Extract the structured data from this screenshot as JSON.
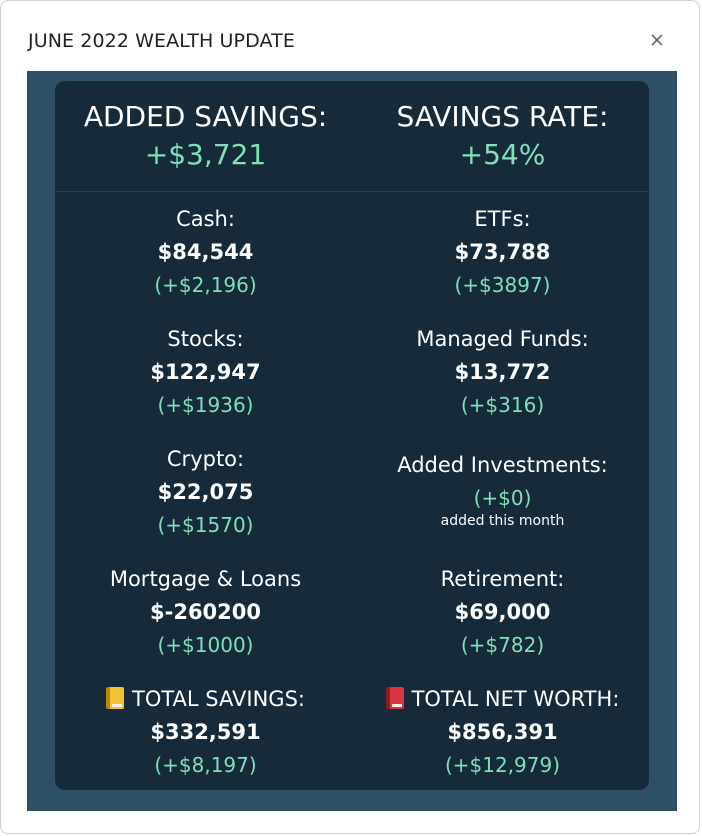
{
  "window": {
    "title": "JUNE 2022 WEALTH UPDATE",
    "close_icon": "close-icon"
  },
  "header": {
    "added_savings_label": "ADDED SAVINGS:",
    "added_savings_value": "+$3,721",
    "savings_rate_label": "SAVINGS RATE:",
    "savings_rate_value": "+54%"
  },
  "rows": [
    {
      "left": {
        "label": "Cash:",
        "value": "$84,544",
        "change": "(+$2,196)"
      },
      "right": {
        "label": "ETFs:",
        "value": "$73,788",
        "change": "(+$3897)"
      }
    },
    {
      "left": {
        "label": "Stocks:",
        "value": "$122,947",
        "change": "(+$1936)"
      },
      "right": {
        "label": "Managed Funds:",
        "value": "$13,772",
        "change": "(+$316)"
      }
    },
    {
      "left": {
        "label": "Crypto:",
        "value": "$22,075",
        "change": "(+$1570)"
      },
      "right": {
        "label": "Added Investments:",
        "change": "(+$0)",
        "note": "added this month"
      }
    },
    {
      "left": {
        "label": "Mortgage & Loans",
        "value": "$-260200",
        "change": "(+$1000)"
      },
      "right": {
        "label": "Retirement:",
        "value": "$69,000",
        "change": "(+$782)"
      }
    }
  ],
  "totals": {
    "savings": {
      "icon": "yellow-ledger-icon",
      "label": "TOTAL SAVINGS:",
      "value": "$332,591",
      "change": "(+$8,197)"
    },
    "net_worth": {
      "icon": "red-book-icon",
      "label": "TOTAL NET WORTH:",
      "value": "$856,391",
      "change": "(+$12,979)"
    }
  },
  "colors": {
    "outer_background": "#2d5066",
    "card_background": "#162a39",
    "accent_green": "#7fe0b9",
    "text_white": "#ffffff"
  }
}
